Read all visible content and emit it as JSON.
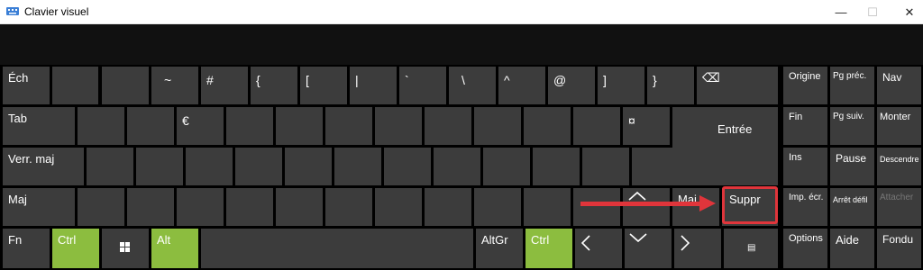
{
  "window": {
    "title": "Clavier visuel",
    "controls": {
      "minimize": "—",
      "maximize": "☐",
      "close": "✕"
    }
  },
  "rows": {
    "row1": {
      "esc": "Éch",
      "k3": "~",
      "k4": "#",
      "k5": "{",
      "k6": "[",
      "k7": "|",
      "k8": "`",
      "k9": "\\",
      "k10": "^",
      "k11": "@",
      "k12": "]",
      "k13": "}",
      "backspace": "⌫"
    },
    "row2": {
      "tab": "Tab",
      "k4": "€",
      "k13": "¤",
      "enter": "Entrée"
    },
    "row3": {
      "caps": "Verr. maj"
    },
    "row4": {
      "shift": "Maj",
      "up": "^",
      "shift_right": "Maj",
      "delete": "Suppr"
    },
    "row5": {
      "fn": "Fn",
      "ctrl": "Ctrl",
      "win": "⊞",
      "alt": "Alt",
      "altgr": "AltGr",
      "ctrl_right": "Ctrl",
      "left": "<",
      "down": "v",
      "right": ">",
      "menu": "▤"
    }
  },
  "nav_keys": {
    "home": "Origine",
    "pgup": "Pg préc.",
    "navigation": "Nav",
    "end": "Fin",
    "pgdn": "Pg suiv.",
    "up": "Monter",
    "ins": "Ins",
    "pause": "Pause",
    "down": "Descendre",
    "prtscn": "Imp. écr.",
    "scrlk": "Arrêt défil",
    "dock": "Attacher",
    "options": "Options",
    "help": "Aide",
    "fade": "Fondu"
  },
  "colors": {
    "accent_green": "#8cbd3f",
    "key_bg": "#3c3c3c",
    "annotation_red": "#e0353b"
  }
}
